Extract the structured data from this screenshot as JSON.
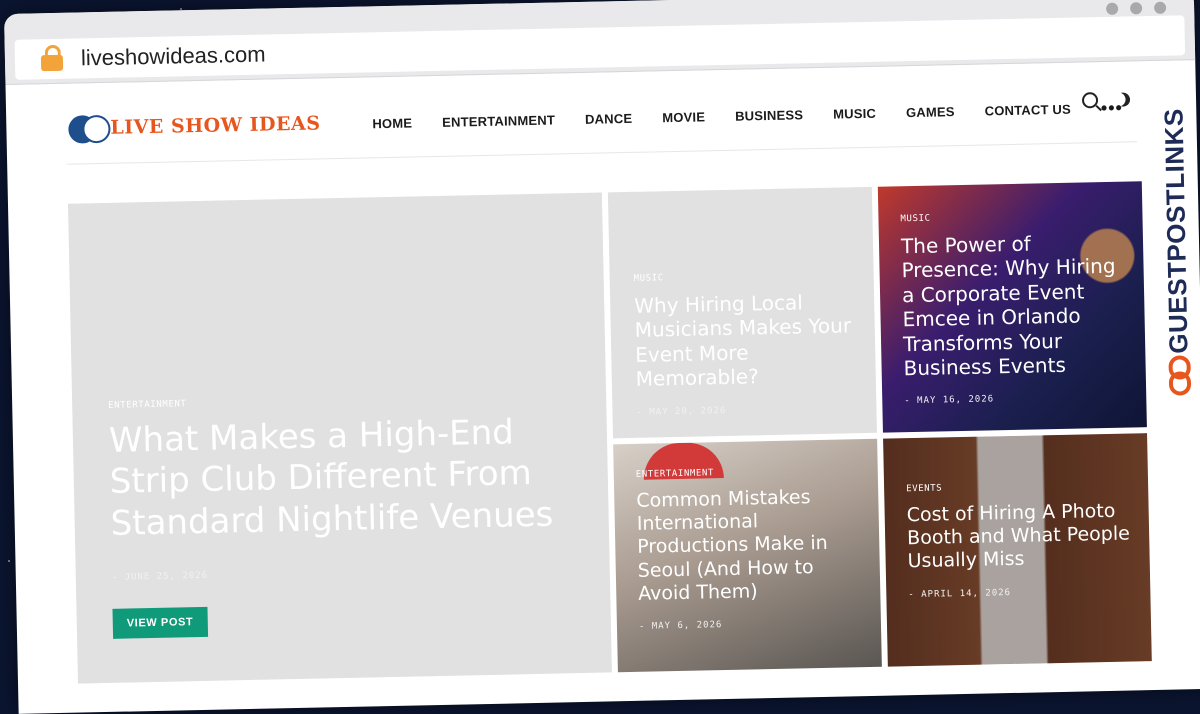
{
  "browser": {
    "url": "liveshowideas.com"
  },
  "site": {
    "logo_text": "LIVE SHOW IDEAS",
    "nav": [
      "HOME",
      "ENTERTAINMENT",
      "DANCE",
      "MOVIE",
      "BUSINESS",
      "MUSIC",
      "GAMES",
      "CONTACT US"
    ],
    "more_label": "•••"
  },
  "cards": {
    "main": {
      "category": "ENTERTAINMENT",
      "title": "What Makes a High-End Strip Club Different From Standard Nightlife Venues",
      "date": "- JUNE 25, 2026",
      "button": "VIEW POST"
    },
    "top1": {
      "category": "MUSIC",
      "title": "Why Hiring Local Musicians Makes Your Event More Memorable?",
      "date": "- MAY 20, 2026"
    },
    "top2": {
      "category": "MUSIC",
      "title": "The Power of Presence: Why Hiring a Corporate Event Emcee in Orlando Transforms Your Business Events",
      "date": "- MAY 16, 2026"
    },
    "bottom1": {
      "category": "ENTERTAINMENT",
      "title": "Common Mistakes International Productions Make in Seoul (And How to Avoid Them)",
      "date": "- MAY 6, 2026"
    },
    "bottom2": {
      "category": "EVENTS",
      "title": "Cost of Hiring A Photo Booth and What People Usually Miss",
      "date": "- APRIL 14, 2026"
    }
  },
  "badge": {
    "text": "GUESTPOSTLINKS"
  },
  "colors": {
    "accent": "#0f9a7a",
    "logo": "#e7571d",
    "badge": "#1f2b57",
    "badge_icon": "#e7571d"
  }
}
